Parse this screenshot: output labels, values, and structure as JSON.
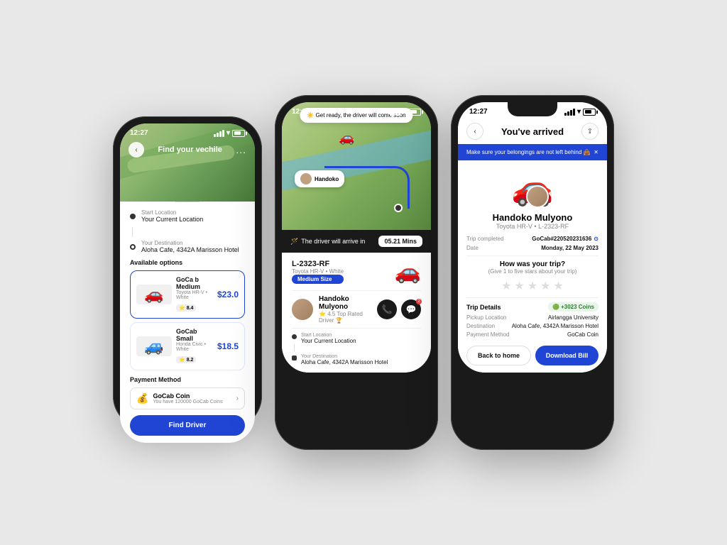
{
  "phone1": {
    "status": {
      "time": "12:27"
    },
    "header": {
      "title": "Find your vechile",
      "back": "‹",
      "menu": "..."
    },
    "start_label": "Start Location",
    "start_value": "Your Current Location",
    "dest_label": "Your Destination",
    "dest_value": "Aloha Cafe, 4342A Marisson Hotel",
    "available_options": "Available options",
    "options": [
      {
        "name": "GoCa b Medium",
        "sub": "Toyota HR-V • White",
        "rating": "8.4",
        "price": "$23.0",
        "selected": true
      },
      {
        "name": "GoCab Small",
        "sub": "Honda Civic • White",
        "rating": "8.2",
        "price": "$18.5",
        "selected": false
      }
    ],
    "payment_method": "Payment Method",
    "payment": {
      "icon": "💰",
      "name": "GoCab Coin",
      "sub": "You have 120000 GoCab Coins"
    },
    "find_btn": "Find Driver"
  },
  "phone2": {
    "status": {
      "time": "12:27"
    },
    "bubble": "☀️ Get ready, the driver will come soon",
    "driver_label": "Handoko",
    "arrive_bar": {
      "icon": "🪄",
      "text": "The driver will arrive in",
      "time": "05.21 Mins"
    },
    "car": {
      "plate": "L-2323-RF",
      "sub": "Toyota HR-V • White",
      "size": "Medium Size"
    },
    "driver": {
      "name": "Handoko Mulyono",
      "title": "Top Rated Driver 🏆",
      "rating": "4.5"
    },
    "start_label": "Start Location",
    "start_value": "Your Current Location",
    "dest_label": "Your Destination",
    "dest_value": "Aloha Cafe, 4342A Marisson Hotel"
  },
  "phone3": {
    "status": {
      "time": "12:27"
    },
    "title": "You've arrived",
    "alert": "Make sure your belongings are not left behind 👜",
    "car_model": "Toyota HR-V • L-2323-RF",
    "driver": {
      "name": "Handoko Mulyono"
    },
    "trip": {
      "completed_label": "Trip completed",
      "completed_value": "GoCab#220520231636",
      "date_label": "Date",
      "date_value": "Monday, 22 May 2023"
    },
    "rating": {
      "question": "How was your trip?",
      "sub": "(Give 1 to five stars about your trip)"
    },
    "details": {
      "header": "Trip Details",
      "coins": "+3023 Coins",
      "pickup_label": "Pickup Location",
      "pickup_value": "Airlangga University",
      "dest_label": "Destination",
      "dest_value": "Aloha Cafe, 4342A Marisson Hotel",
      "payment_label": "Payment Method",
      "payment_value": "GoCab Coin"
    },
    "btn_back": "Back to home",
    "btn_download": "Download Bill"
  }
}
